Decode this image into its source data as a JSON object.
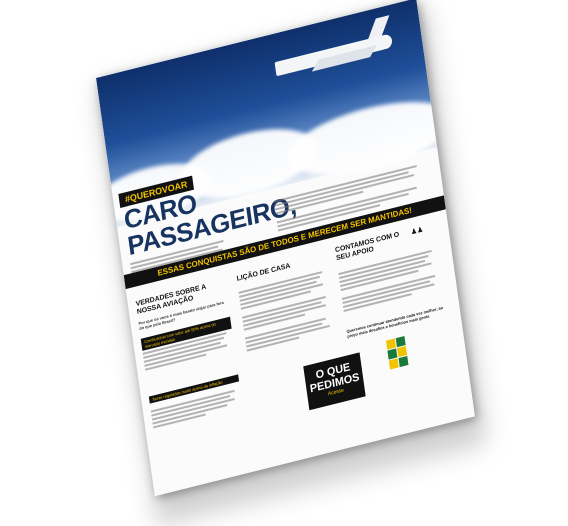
{
  "flyer": {
    "hashtag": "#QUEROVOAR",
    "title_line1": "CARO",
    "title_line2": "PASSAGEIRO,",
    "banner": "ESSAS CONQUISTAS SÃO DE TODOS E MERECEM SER MANTIDAS!",
    "col1_heading": "VERDADES SOBRE A NOSSA AVIAÇÃO",
    "col1_sub": "Por que os voos é mais barato viajar para fora do que pelo Brasil?",
    "col1_item1": "Combustível com valor até 50% acima do mercado mundial",
    "col1_item2": "Taxas reguladas muito acima da inflação",
    "col2_heading": "LIÇÃO DE CASA",
    "col3_heading": "CONTAMOS COM O SEU APOIO",
    "box_big": "O QUE PEDIMOS",
    "box_small": "Acesse",
    "closing": "Queremos continuar atendendo cada vez melhor, ao preço mais desafios e benefícios mais gente"
  },
  "colors": {
    "navy": "#17335f",
    "yellow": "#f2c300",
    "black": "#111111"
  }
}
